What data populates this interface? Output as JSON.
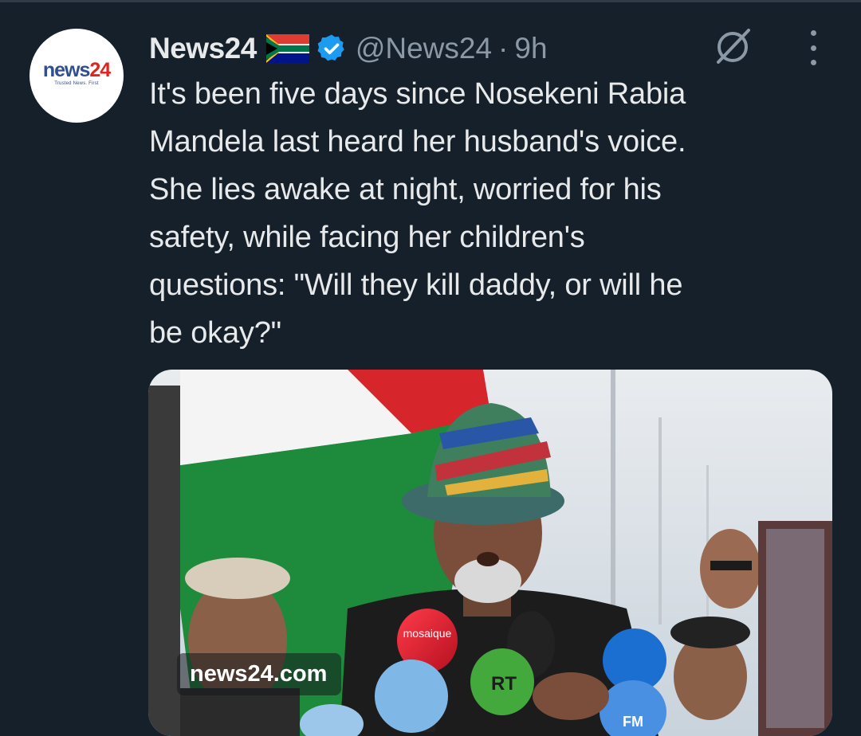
{
  "tweet": {
    "author": {
      "display_name": "News24",
      "handle": "@News24",
      "separator": "·",
      "time": "9h",
      "flag_icon": "south-africa-flag-icon",
      "verified_icon": "verified-badge-icon",
      "avatar": {
        "logo_part1": "news",
        "logo_part2": "24",
        "tagline": "Trusted News. First"
      }
    },
    "text": "It's been five days since Nosekeni Rabia\nMandela last heard her husband's voice.\nShe lies awake at night, worried for his\nsafety, while facing her children's\nquestions: \"Will they kill daddy, or will he\nbe okay?\"",
    "media": {
      "watermark": "news24.com",
      "mic_labels": [
        "mosaique",
        "RT",
        "FM"
      ]
    },
    "actions": {
      "grok_icon": "grok-icon",
      "more_icon": "more-dots-icon"
    }
  },
  "colors": {
    "background": "#15202b",
    "text_primary": "#e7e9ea",
    "text_secondary": "#8b98a5",
    "verified_blue": "#1d9bf0",
    "logo_blue": "#2f4f8f",
    "logo_red": "#e0241f"
  }
}
